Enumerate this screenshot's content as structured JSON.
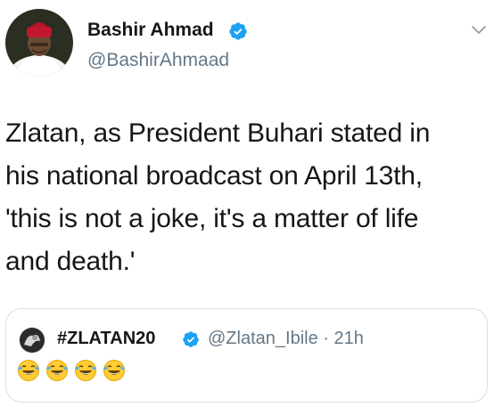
{
  "tweet": {
    "display_name": "Bashir Ahmad",
    "handle": "@BashirAhmaad",
    "verified": true,
    "text": "Zlatan, as President Buhari stated in\nhis national broadcast on April 13th,\n'this is not a joke, it's a matter of life\nand death.'",
    "icons": {
      "avatar": "profile-photo",
      "verified": "verified-badge-icon",
      "menu": "chevron-down-icon"
    },
    "colors": {
      "verified": "#1da1f2",
      "secondary_text": "#657786",
      "primary_text": "#14171a",
      "border": "#d9dfe3"
    }
  },
  "quoted_tweet": {
    "display_name": "#ZLATAN20",
    "handle_time": "@Zlatan_Ibile · 21h",
    "verified": true,
    "emoji_count": 4,
    "emoji_name": "face-with-tears-of-joy-emoji"
  }
}
